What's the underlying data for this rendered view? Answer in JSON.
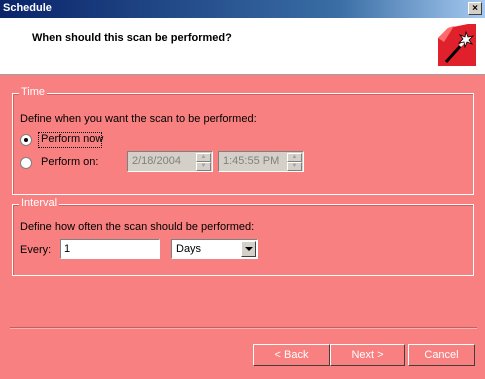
{
  "window": {
    "title": "Schedule",
    "close_glyph": "×"
  },
  "header": {
    "heading": "When should this scan be performed?",
    "icon": "magic-wand-icon"
  },
  "time_group": {
    "legend": "Time",
    "description": "Define when you want the scan to be performed:",
    "option_now": "Perform now",
    "option_on": "Perform on:",
    "selected": "now",
    "date": "2/18/2004",
    "time": "1:45:55 PM"
  },
  "interval_group": {
    "legend": "Interval",
    "description": "Define how often the scan should be performed:",
    "every_label": "Every:",
    "every_value": "1",
    "unit": "Days"
  },
  "buttons": {
    "back": "< Back",
    "next": "Next >",
    "cancel": "Cancel"
  },
  "colors": {
    "panel_background": "#f98080",
    "title_bar": "#0a246a"
  }
}
